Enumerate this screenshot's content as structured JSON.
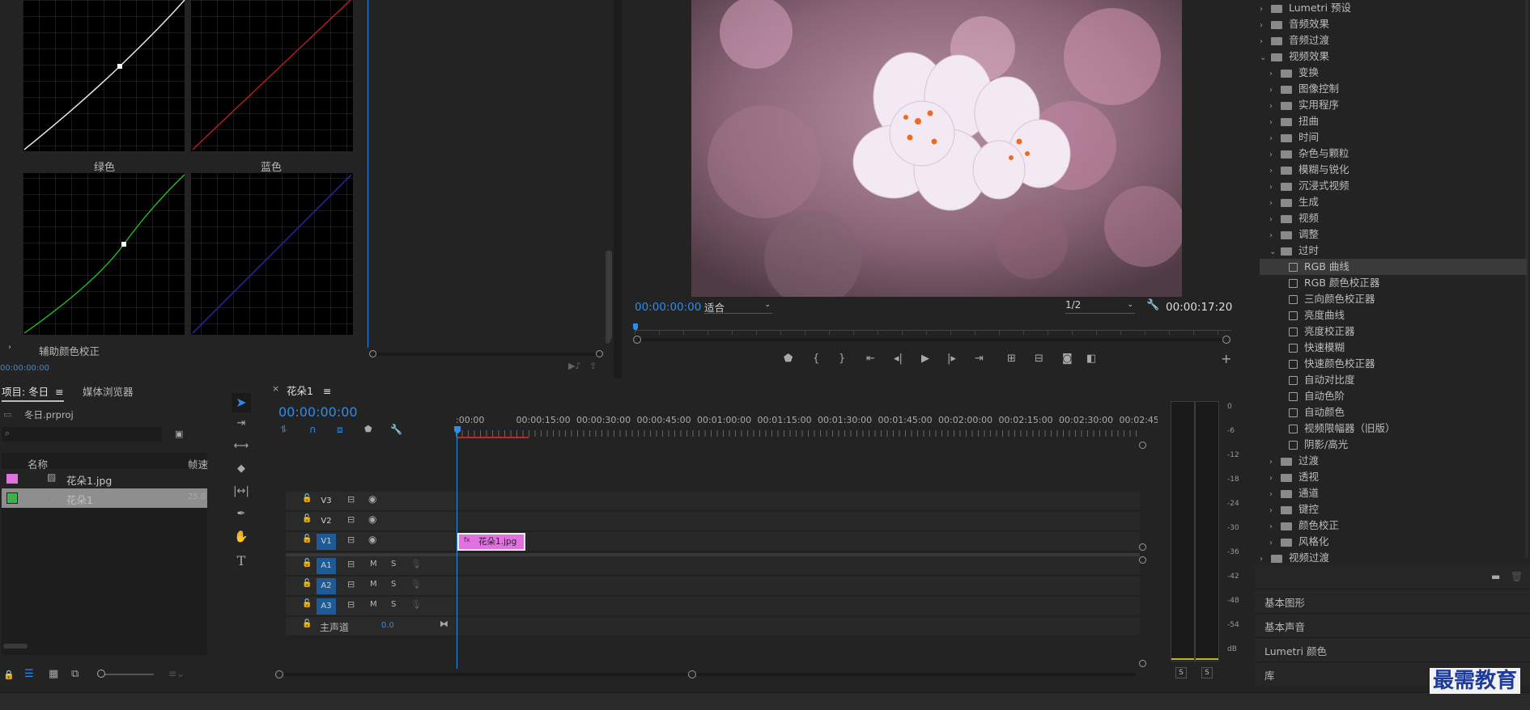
{
  "curves": {
    "green_label": "绿色",
    "blue_label": "蓝色",
    "secondary_label": "辅助颜色校正",
    "timecode": "00:00:00:00"
  },
  "program": {
    "timecode": "00:00:00:00",
    "fit": "适合",
    "resolution": "1/2",
    "duration": "00:00:17:20"
  },
  "project": {
    "tab_project": "项目: 冬日",
    "tab_media": "媒体浏览器",
    "file": "冬日.prproj",
    "col_name": "名称",
    "col_rate": "帧速",
    "items": [
      {
        "name": "花朵1.jpg",
        "color": "#e072e0"
      },
      {
        "name": "花朵1",
        "color": "#3fb04b",
        "rate": "25.0"
      }
    ]
  },
  "timeline": {
    "tab": "花朵1",
    "timecode": "00:00:00:00",
    "ruler": [
      ":00:00",
      "00:00:15:00",
      "00:00:30:00",
      "00:00:45:00",
      "00:01:00:00",
      "00:01:15:00",
      "00:01:30:00",
      "00:01:45:00",
      "00:02:00:00",
      "00:02:15:00",
      "00:02:30:00",
      "00:02:45:"
    ],
    "video_tracks": [
      "V3",
      "V2",
      "V1"
    ],
    "audio_tracks": [
      "A1",
      "A2",
      "A3"
    ],
    "master": "主声道",
    "master_val": "0.0",
    "clip": "花朵1.jpg",
    "m": "M",
    "s": "S"
  },
  "meter": {
    "labels": [
      "0",
      "-6",
      "-12",
      "-18",
      "-24",
      "-30",
      "-36",
      "-42",
      "-48",
      "-54",
      "dB"
    ],
    "solo": [
      "S",
      "S"
    ]
  },
  "effects": {
    "items": [
      {
        "label": "Lumetri 预设",
        "level": 0,
        "type": "folder",
        "expanded": false
      },
      {
        "label": "音频效果",
        "level": 0,
        "type": "folder",
        "expanded": false
      },
      {
        "label": "音频过渡",
        "level": 0,
        "type": "folder",
        "expanded": false
      },
      {
        "label": "视频效果",
        "level": 0,
        "type": "folder",
        "expanded": true
      },
      {
        "label": "变换",
        "level": 1,
        "type": "folder",
        "expanded": false
      },
      {
        "label": "图像控制",
        "level": 1,
        "type": "folder",
        "expanded": false
      },
      {
        "label": "实用程序",
        "level": 1,
        "type": "folder",
        "expanded": false
      },
      {
        "label": "扭曲",
        "level": 1,
        "type": "folder",
        "expanded": false
      },
      {
        "label": "时间",
        "level": 1,
        "type": "folder",
        "expanded": false
      },
      {
        "label": "杂色与颗粒",
        "level": 1,
        "type": "folder",
        "expanded": false
      },
      {
        "label": "模糊与锐化",
        "level": 1,
        "type": "folder",
        "expanded": false
      },
      {
        "label": "沉浸式视频",
        "level": 1,
        "type": "folder",
        "expanded": false
      },
      {
        "label": "生成",
        "level": 1,
        "type": "folder",
        "expanded": false
      },
      {
        "label": "视频",
        "level": 1,
        "type": "folder",
        "expanded": false
      },
      {
        "label": "调整",
        "level": 1,
        "type": "folder",
        "expanded": false
      },
      {
        "label": "过时",
        "level": 1,
        "type": "folder",
        "expanded": true
      },
      {
        "label": "RGB 曲线",
        "level": 2,
        "type": "fx",
        "selected": true
      },
      {
        "label": "RGB 颜色校正器",
        "level": 2,
        "type": "fx"
      },
      {
        "label": "三向颜色校正器",
        "level": 2,
        "type": "fx"
      },
      {
        "label": "亮度曲线",
        "level": 2,
        "type": "fx"
      },
      {
        "label": "亮度校正器",
        "level": 2,
        "type": "fx"
      },
      {
        "label": "快速模糊",
        "level": 2,
        "type": "fx"
      },
      {
        "label": "快速颜色校正器",
        "level": 2,
        "type": "fx"
      },
      {
        "label": "自动对比度",
        "level": 2,
        "type": "fx"
      },
      {
        "label": "自动色阶",
        "level": 2,
        "type": "fx"
      },
      {
        "label": "自动颜色",
        "level": 2,
        "type": "fx"
      },
      {
        "label": "视频限幅器（旧版）",
        "level": 2,
        "type": "fx"
      },
      {
        "label": "阴影/高光",
        "level": 2,
        "type": "fx"
      },
      {
        "label": "过渡",
        "level": 1,
        "type": "folder",
        "expanded": false
      },
      {
        "label": "透视",
        "level": 1,
        "type": "folder",
        "expanded": false
      },
      {
        "label": "通道",
        "level": 1,
        "type": "folder",
        "expanded": false
      },
      {
        "label": "键控",
        "level": 1,
        "type": "folder",
        "expanded": false
      },
      {
        "label": "颜色校正",
        "level": 1,
        "type": "folder",
        "expanded": false
      },
      {
        "label": "风格化",
        "level": 1,
        "type": "folder",
        "expanded": false
      },
      {
        "label": "视频过渡",
        "level": 0,
        "type": "folder",
        "expanded": false
      }
    ],
    "panels": [
      "基本图形",
      "基本声音",
      "Lumetri 颜色",
      "库"
    ]
  },
  "watermark": "最需教育",
  "colors": {
    "accent": "#2d8ceb",
    "track_on": "#1e5a96",
    "clip": "#e072e0",
    "playhead": "#2d8ceb"
  }
}
